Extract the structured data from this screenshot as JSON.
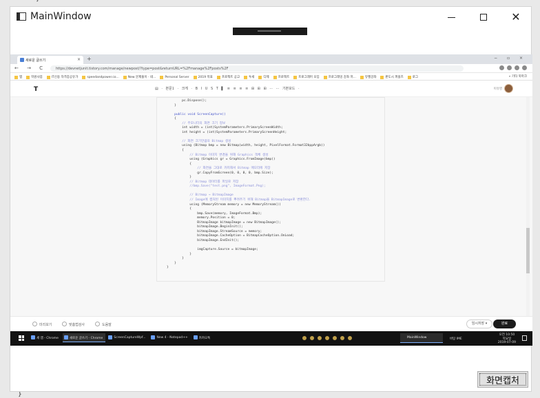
{
  "window": {
    "title": "MainWindow",
    "controls": {
      "minimize": "—",
      "maximize": "□",
      "close": "✕"
    }
  },
  "capture_button": {
    "label": "화면캡처"
  },
  "screenshot": {
    "browser": {
      "tab_title": "새로운 글쓰기",
      "tab_close": "×",
      "new_tab": "+",
      "window_controls": "− ▫ ×",
      "nav": "← → C",
      "url": "https://devnetjunit.tistory.com/manage/newpost/?type=post&returnURL=%2Fmanage%2Fposts%2F",
      "bookmarks": [
        "앱",
        "학원사업",
        "IT신용 자격증공유가",
        "speedandpower.co...",
        "New 문제풀이 · 네...",
        "Personal Server",
        "2019 목표",
        "프로젝트 공고",
        "투세",
        "디제",
        "프로젝트",
        "프로그래머 모임",
        "프로그래밍 강좌 저...",
        "뮤젤강좌",
        "판도시 퍼플즈",
        "로그"
      ],
      "bookmark_right": "»  기타 북마크"
    },
    "editor": {
      "logo": "T",
      "toolbar": "▤ · 본문1 · 크게 ·    B  I  U  S  T  ▌   ≡  ≡  ≡  ≡    ⊞  ⊞  ⊞  ···  ···   기본모드 ·",
      "user": "이유영",
      "code_lines": [
        {
          "t": "        pc.Dispose();",
          "c": ""
        },
        {
          "t": "    }",
          "c": ""
        },
        {
          "t": "",
          "c": ""
        },
        {
          "t": "    public void ScreenCapture()",
          "c": "kw"
        },
        {
          "t": "    {",
          "c": ""
        },
        {
          "t": "        // 주모니터의 화면 크기 정보",
          "c": "cm"
        },
        {
          "t": "        int width = (int)SystemParameters.PrimaryScreenWidth;",
          "c": ""
        },
        {
          "t": "        int height = (int)SystemParameters.PrimaryScreenHeight;",
          "c": ""
        },
        {
          "t": "",
          "c": ""
        },
        {
          "t": "        // 화면 크기만큼의 Bitmap 생성",
          "c": "cm"
        },
        {
          "t": "        using (Bitmap bmp = new Bitmap(width, height, PixelFormat.Format32bppArgb))",
          "c": ""
        },
        {
          "t": "        {",
          "c": ""
        },
        {
          "t": "            // Bitmap 이미지 변경을 위해 Graphics 객체 생성",
          "c": "cm"
        },
        {
          "t": "            using (Graphics gr = Graphics.FromImage(bmp))",
          "c": ""
        },
        {
          "t": "            {",
          "c": ""
        },
        {
          "t": "                // 화면을 그대로 카피해서 Bitmap 메모리에 저장",
          "c": "cm"
        },
        {
          "t": "                gr.CopyFromScreen(0, 0, 0, 0, bmp.Size);",
          "c": ""
        },
        {
          "t": "            }",
          "c": ""
        },
        {
          "t": "            // Bitmap 데이터를 파일로 저장",
          "c": "cm"
        },
        {
          "t": "            //bmp.Save(\"test.png\", ImageFormat.Png);",
          "c": "cm"
        },
        {
          "t": "",
          "c": ""
        },
        {
          "t": "            // Bitmap → BitmapImage",
          "c": "cm"
        },
        {
          "t": "            // Image에 캡처된 이미지를 뿌려주기 위해 Bitmap을 BitmapImage로 변환한다.",
          "c": "cm"
        },
        {
          "t": "            using (MemoryStream memory = new MemoryStream())",
          "c": ""
        },
        {
          "t": "            {",
          "c": ""
        },
        {
          "t": "                bmp.Save(memory, ImageFormat.Bmp);",
          "c": ""
        },
        {
          "t": "                memory.Position = 0;",
          "c": ""
        },
        {
          "t": "                BitmapImage bitmapImage = new BitmapImage();",
          "c": ""
        },
        {
          "t": "                bitmapImage.BeginInit();",
          "c": ""
        },
        {
          "t": "                bitmapImage.StreamSource = memory;",
          "c": ""
        },
        {
          "t": "                bitmapImage.CacheOption = BitmapCacheOption.OnLoad;",
          "c": ""
        },
        {
          "t": "                bitmapImage.EndInit();",
          "c": ""
        },
        {
          "t": "",
          "c": ""
        },
        {
          "t": "                imgCapture.Source = bitmapImage;",
          "c": ""
        },
        {
          "t": "            }",
          "c": ""
        },
        {
          "t": "        }",
          "c": ""
        },
        {
          "t": "    }",
          "c": ""
        },
        {
          "t": "}",
          "c": ""
        }
      ],
      "footer": {
        "preview": "미리보기",
        "spellcheck": "맞춤법검사",
        "fullscreen": "도움말",
        "save": "임시저장  ▾",
        "publish": "완료"
      }
    },
    "taskbar": {
      "apps": [
        "세 앱 - Chrome",
        "새로운 글쓰기 - Chrome",
        "ScreenCaptureWpf...",
        "New 4 - Notepad++",
        "카카오톡"
      ],
      "active_app": "MainWindow",
      "lang": "바탕 IME",
      "clock_time": "오전 10:50",
      "clock_day": "목요일",
      "clock_date": "2019-07-09"
    }
  }
}
